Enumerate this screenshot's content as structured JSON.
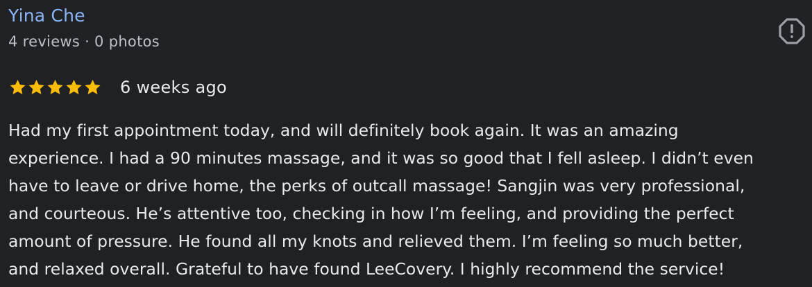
{
  "reviewer": {
    "name": "Yina Che",
    "meta": "4 reviews · 0 photos"
  },
  "report": {
    "icon": "report-flag-icon"
  },
  "rating": {
    "stars": 5,
    "max": 5,
    "star_color": "#fbbc04",
    "date": "6 weeks ago"
  },
  "review": {
    "lines": [
      "Had my first appointment today, and will definitely book again. It was an amazing",
      "experience. I had a 90 minutes massage, and it was so good that I fell asleep. I didn’t even",
      "have to leave or drive home, the perks of outcall massage! Sangjin was very professional,",
      "and courteous. He’s attentive too, checking in how I’m feeling, and providing the perfect",
      "amount of pressure. He found all my knots and relieved them. I’m feeling so much better,",
      "and relaxed overall. Grateful to have found LeeCovery. I highly recommend the service!"
    ]
  },
  "colors": {
    "background": "#202124",
    "name_link": "#8ab4f8",
    "text_primary": "#e8eaed",
    "text_secondary": "#bdc1c6"
  }
}
